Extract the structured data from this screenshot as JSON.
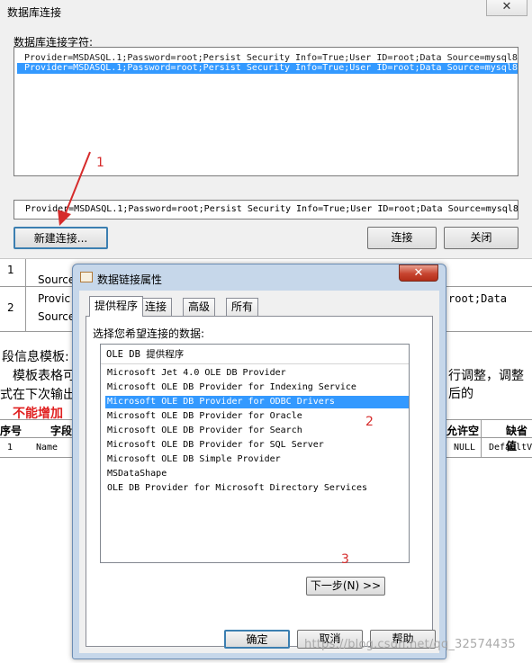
{
  "outer_dialog": {
    "title": "数据库连接",
    "close_glyph": "✕",
    "conn_label": "数据库连接字符:",
    "connections": [
      "Provider=MSDASQL.1;Password=root;Persist Security Info=True;User ID=root;Data Source=mysql8",
      "Provider=MSDASQL.1;Password=root;Persist Security Info=True;User ID=root;Data Source=mysql8"
    ],
    "current_text": "Provider=MSDASQL.1;Password=root;Persist Security Info=True;User ID=root;Data Source=mysql8",
    "new_button": "新建连接...",
    "connect_button": "连接",
    "close_button": "关闭",
    "annotation": "1"
  },
  "document": {
    "row1_num": "1",
    "row1_a": "Source",
    "row2_num": "2",
    "row2_a": "Provic",
    "row2_b": "Source",
    "row2_right": "root;Data",
    "heading": "段信息模板:",
    "line1_a": "模板表格可",
    "line1_b": "行调整，调整后的",
    "line2": "式在下次输出",
    "red_text": "不能增加",
    "col_seq": "序号",
    "col_field": "字段",
    "col_null": "允许空",
    "col_default": "缺省值",
    "r_num": "1",
    "r_name": "Name",
    "r_null": "NULL",
    "r_default": "DefaultVal"
  },
  "inner_dialog": {
    "title": "数据链接属性",
    "close_glyph": "✕",
    "tabs": [
      "提供程序",
      "连接",
      "高级",
      "所有"
    ],
    "select_label": "选择您希望连接的数据:",
    "list_header": "OLE DB 提供程序",
    "providers": [
      "Microsoft Jet 4.0 OLE DB Provider",
      "Microsoft OLE DB Provider for Indexing Service",
      "Microsoft OLE DB Provider for ODBC Drivers",
      "Microsoft OLE DB Provider for Oracle",
      "Microsoft OLE DB Provider for Search",
      "Microsoft OLE DB Provider for SQL Server",
      "Microsoft OLE DB Simple Provider",
      "MSDataShape",
      "OLE DB Provider for Microsoft Directory Services"
    ],
    "selected_index": 2,
    "next_button": "下一步(N) >>",
    "ok_button": "确定",
    "cancel_button": "取消",
    "help_button": "帮助",
    "annotation_2": "2",
    "annotation_3": "3"
  },
  "watermark": "https://blog.csdn.net/qq_32574435",
  "colors": {
    "selection": "#3399ff",
    "annotation": "#d62b2b",
    "window_frame": "#c6d7ea"
  }
}
